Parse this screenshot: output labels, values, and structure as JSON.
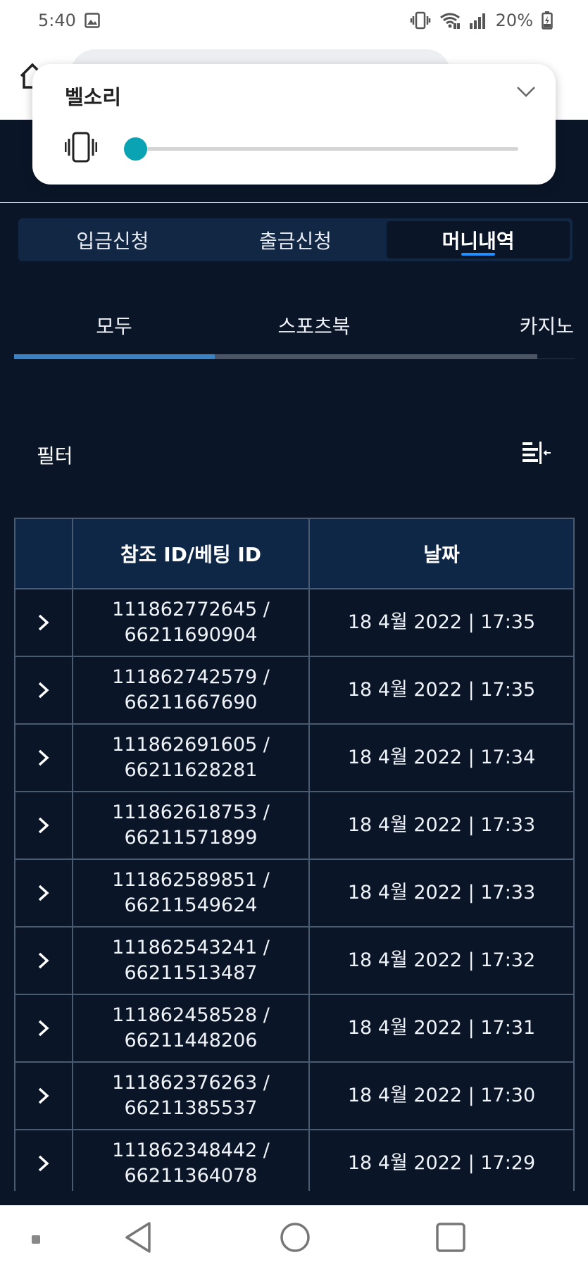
{
  "status_bar": {
    "time": "5:40",
    "battery": "20%",
    "icons": [
      "image-icon",
      "vibrate-icon",
      "wifi-icon",
      "signal-icon",
      "battery-icon"
    ]
  },
  "volume_panel": {
    "title": "벨소리",
    "level": 0,
    "accent_color": "#0aa3b4"
  },
  "main_tabs": [
    {
      "label": "입금신청",
      "active": false
    },
    {
      "label": "출금신청",
      "active": false
    },
    {
      "label": "머니내역",
      "active": true
    }
  ],
  "sub_tabs": [
    {
      "label": "모두",
      "active": true
    },
    {
      "label": "스포츠북",
      "active": false
    },
    {
      "label": "카지노",
      "active": false
    }
  ],
  "filter": {
    "label": "필터"
  },
  "table": {
    "headers": [
      "",
      "참조 ID/베팅 ID",
      "날짜"
    ],
    "rows": [
      {
        "ref_id": "111862772645 /",
        "bet_id": "66211690904",
        "date": "18 4월 2022 | 17:35"
      },
      {
        "ref_id": "111862742579 /",
        "bet_id": "66211667690",
        "date": "18 4월 2022 | 17:35"
      },
      {
        "ref_id": "111862691605 /",
        "bet_id": "66211628281",
        "date": "18 4월 2022 | 17:34"
      },
      {
        "ref_id": "111862618753 /",
        "bet_id": "66211571899",
        "date": "18 4월 2022 | 17:33"
      },
      {
        "ref_id": "111862589851 /",
        "bet_id": "66211549624",
        "date": "18 4월 2022 | 17:33"
      },
      {
        "ref_id": "111862543241 /",
        "bet_id": "66211513487",
        "date": "18 4월 2022 | 17:32"
      },
      {
        "ref_id": "111862458528 /",
        "bet_id": "66211448206",
        "date": "18 4월 2022 | 17:31"
      },
      {
        "ref_id": "111862376263 /",
        "bet_id": "66211385537",
        "date": "18 4월 2022 | 17:30"
      },
      {
        "ref_id": "111862348442 /",
        "bet_id": "66211364078",
        "date": "18 4월 2022 | 17:29"
      }
    ]
  },
  "colors": {
    "background": "#0a1628",
    "header_cell": "#0f2747",
    "active_tab_indicator": "#1e90ff",
    "sub_tab_indicator": "#3b82c4"
  }
}
